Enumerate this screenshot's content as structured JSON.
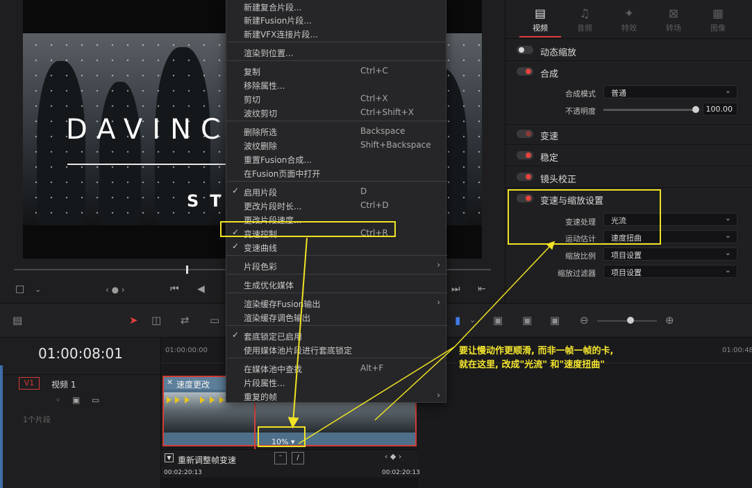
{
  "viewer": {
    "title_main": "DAVINC",
    "title_sub": "ST"
  },
  "inspector": {
    "tabs": [
      {
        "label": "视频",
        "icon": "film-icon",
        "active": true
      },
      {
        "label": "音频",
        "icon": "music-note-icon",
        "active": false
      },
      {
        "label": "特效",
        "icon": "magic-wand-icon",
        "active": false
      },
      {
        "label": "转场",
        "icon": "transition-icon",
        "active": false
      },
      {
        "label": "图像",
        "icon": "image-icon",
        "active": false
      }
    ],
    "sections": {
      "dynamic_zoom": "动态缩放",
      "composite": "合成",
      "speed_change": "变速",
      "stabilization": "稳定",
      "lens_correction": "镜头校正",
      "retime_scaling": "变速与缩放设置"
    },
    "props": {
      "composite_mode_label": "合成模式",
      "composite_mode_value": "普通",
      "opacity_label": "不透明度",
      "opacity_value": "100.00",
      "retime_process_label": "变速处理",
      "retime_process_value": "光流",
      "motion_estimation_label": "运动估计",
      "motion_estimation_value": "速度扭曲",
      "scaling_label": "缩放比例",
      "scaling_value": "项目设置",
      "resize_filter_label": "缩放过滤器",
      "resize_filter_value": "项目设置"
    }
  },
  "context_menu": {
    "items": [
      {
        "label": "新建复合片段...",
        "shortcut": ""
      },
      {
        "label": "新建Fusion片段...",
        "shortcut": ""
      },
      {
        "label": "新建VFX连接片段...",
        "shortcut": ""
      },
      {
        "label": "渲染到位置...",
        "shortcut": ""
      },
      {
        "label": "复制",
        "shortcut": "Ctrl+C"
      },
      {
        "label": "移除属性...",
        "shortcut": ""
      },
      {
        "label": "剪切",
        "shortcut": "Ctrl+X"
      },
      {
        "label": "波纹剪切",
        "shortcut": "Ctrl+Shift+X"
      },
      {
        "label": "删除所选",
        "shortcut": "Backspace"
      },
      {
        "label": "波纹删除",
        "shortcut": "Shift+Backspace"
      },
      {
        "label": "重置Fusion合成...",
        "shortcut": ""
      },
      {
        "label": "在Fusion页面中打开",
        "shortcut": ""
      },
      {
        "label": "启用片段",
        "shortcut": "D",
        "checked": true
      },
      {
        "label": "更改片段时长...",
        "shortcut": "Ctrl+D"
      },
      {
        "label": "更改片段速度...",
        "shortcut": ""
      },
      {
        "label": "变速控制",
        "shortcut": "Ctrl+R",
        "checked": true
      },
      {
        "label": "变速曲线",
        "shortcut": "",
        "checked": true
      },
      {
        "label": "片段色彩",
        "shortcut": "",
        "submenu": true
      },
      {
        "label": "生成优化媒体",
        "shortcut": ""
      },
      {
        "label": "渲染缓存Fusion输出",
        "shortcut": "",
        "submenu": true
      },
      {
        "label": "渲染缓存调色输出",
        "shortcut": ""
      },
      {
        "label": "套底锁定已启用",
        "shortcut": "",
        "checked": true
      },
      {
        "label": "使用媒体池片段进行套底锁定",
        "shortcut": ""
      },
      {
        "label": "在媒体池中查找",
        "shortcut": "Alt+F"
      },
      {
        "label": "片段属性...",
        "shortcut": ""
      },
      {
        "label": "重复的帧",
        "shortcut": "",
        "submenu": true
      }
    ]
  },
  "timeline": {
    "timecode": "01:00:08:01",
    "ruler": [
      "01:00:00:00",
      "01:00:48"
    ],
    "track": {
      "id": "V1",
      "name": "视频 1",
      "clip_count": "1个片段"
    },
    "clip": {
      "title": "速度更改",
      "speed": "10%"
    },
    "retime": {
      "label": "重新调整帧变速",
      "tc_start": "00:02:20:13",
      "tc_end": "00:02:20:13"
    }
  },
  "annotation": {
    "line1": "要让慢动作更顺滑, 而非一帧一帧的卡,",
    "line2": "就在这里, 改成\"光流\" 和\"速度扭曲\""
  },
  "colors": {
    "highlight": "#f2e324",
    "accent_red": "#e5433e",
    "clip_blue": "#4e6f8a"
  }
}
